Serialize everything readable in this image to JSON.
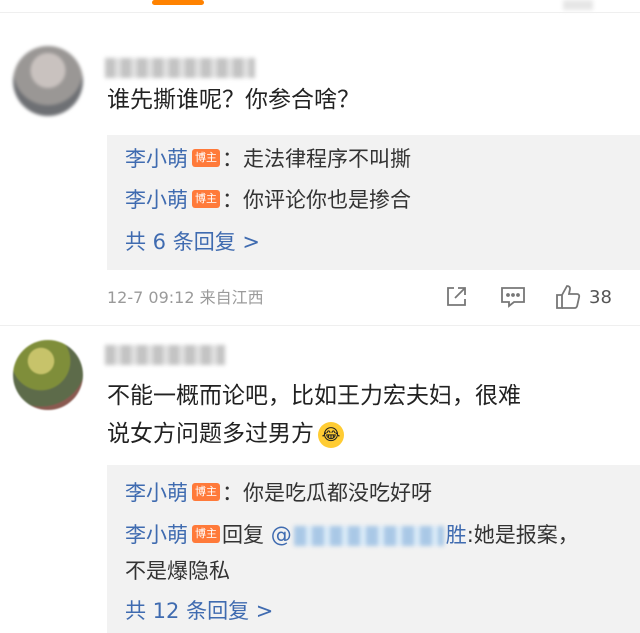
{
  "comment1": {
    "text": "谁先撕谁呢？你参合啥？",
    "replies": [
      {
        "author": "李小萌",
        "badge": "博主",
        "text": "：走法律程序不叫撕"
      },
      {
        "author": "李小萌",
        "badge": "博主",
        "text": "：你评论你也是掺合"
      }
    ],
    "more_label": "共 6 条回复 >",
    "meta": "12-7 09:12  来自江西",
    "like_count": "38",
    "icons": [
      "share-icon",
      "comment-icon",
      "like-icon"
    ]
  },
  "comment2": {
    "text_line1": "不能一概而论吧，比如王力宏夫妇，很难",
    "text_line2": "说女方问题多过男方",
    "emoji": "😂",
    "replies": [
      {
        "author": "李小萌",
        "badge": "博主",
        "text": "：你是吃瓜都没吃好呀"
      },
      {
        "author": "李小萌",
        "badge": "博主",
        "prefix": "回复 ",
        "mention_tail": "胜",
        "text": ":她是报案，",
        "text_line2": "不是爆隐私"
      }
    ],
    "more_label": "共 12 条回复 >"
  },
  "colors": {
    "accent": "#ff8200",
    "link": "#3f6bb0",
    "badge": "#ff7a3a",
    "reply_bg": "#f2f2f2",
    "meta": "#9a9a9a"
  }
}
